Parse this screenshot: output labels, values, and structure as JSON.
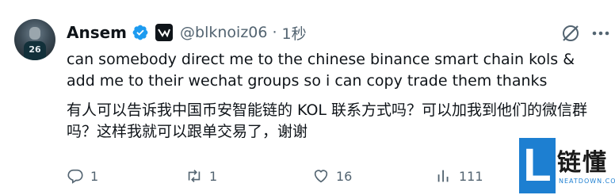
{
  "tweet": {
    "author_name": "Ansem",
    "handle": "@blknoiz06",
    "separator": "·",
    "time": "1秒",
    "avatar_number": "26",
    "text_en": "can somebody direct me to the chinese binance smart chain kols & add me to their wechat groups so i can copy trade them thanks",
    "text_zh": "有人可以告诉我中国币安智能链的 KOL 联系方式吗？可以加我到他们的微信群吗？这样我就可以跟单交易了，谢谢",
    "accent_color": "#1d9bf0"
  },
  "actions": {
    "replies": "1",
    "reposts": "1",
    "likes": "16",
    "views": "111"
  },
  "watermark": {
    "letter": "L",
    "text": "链懂",
    "site": "NEATDOWN.COM"
  }
}
